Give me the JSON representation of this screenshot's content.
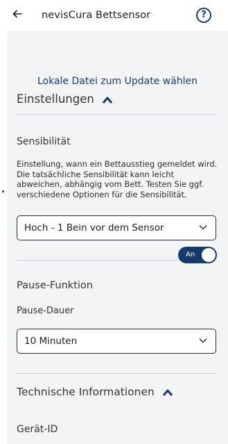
{
  "header": {
    "title": "nevisCura Bettsensor",
    "back_icon": "arrow-left-icon",
    "help_icon": "question-circle-icon"
  },
  "update": {
    "link_text": "Lokale Datei zum Update wählen"
  },
  "settings": {
    "heading": "Einstellungen",
    "sensitivity": {
      "label": "Sensibilität",
      "description": "Einstellung, wann ein Bettausstieg gemeldet wird. Die tatsächliche Sensibilität kann leicht abweichen, abhängig vom Bett. Testen Sie ggf. verschiedene Optionen für die Sensibilität.",
      "selected": "Hoch - 1 Bein vor dem Sensor"
    },
    "pause": {
      "label": "Pause-Funktion",
      "toggle_text": "An",
      "toggle_on": true,
      "duration_label": "Pause-Dauer",
      "duration_selected": "10 Minuten"
    }
  },
  "tech": {
    "heading": "Technische Informationen",
    "device_id_label": "Gerät-ID"
  },
  "colors": {
    "accent": "#163a6e",
    "panel": "#f3f4f6",
    "divider": "#c9ccd1"
  }
}
